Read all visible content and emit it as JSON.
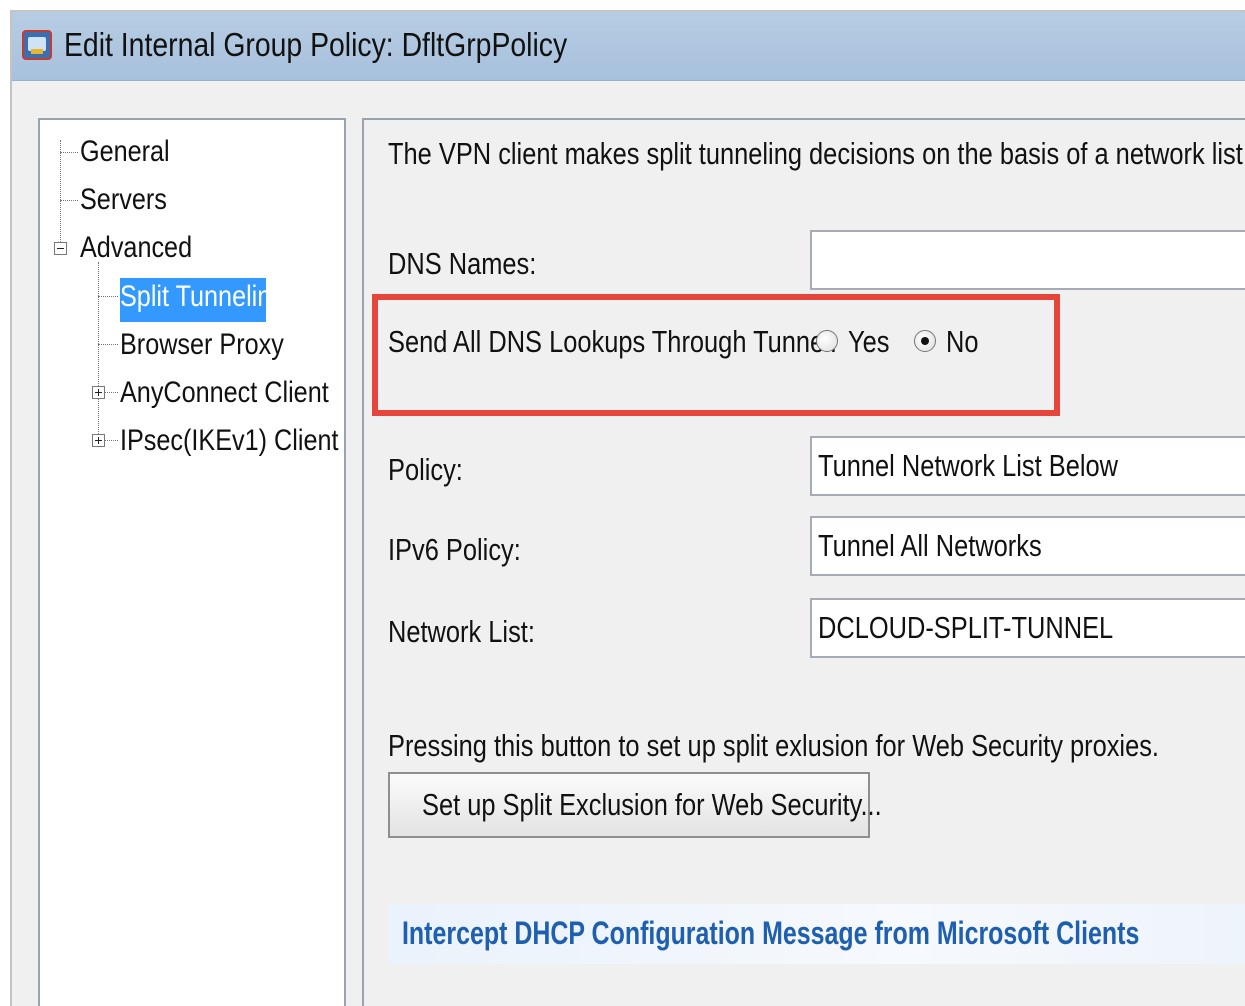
{
  "window": {
    "title": "Edit Internal Group Policy: DfltGrpPolicy",
    "icon": "group-policy-icon"
  },
  "tree": {
    "items": [
      {
        "label": "General"
      },
      {
        "label": "Servers"
      },
      {
        "label": "Advanced"
      },
      {
        "label": "Split Tunneling",
        "selected": true
      },
      {
        "label": "Browser Proxy"
      },
      {
        "label": "AnyConnect Client"
      },
      {
        "label": "IPsec(IKEv1) Client"
      }
    ]
  },
  "panel": {
    "description": "The VPN client makes split tunneling decisions on the basis of a network list that can b",
    "dns_names_label": "DNS Names:",
    "dns_names_value": "",
    "send_dns_label": "Send All DNS Lookups Through Tunnel:",
    "send_dns_yes": "Yes",
    "send_dns_no": "No",
    "send_dns_selected": "No",
    "policy_label": "Policy:",
    "policy_value": "Tunnel Network List Below",
    "ipv6_policy_label": "IPv6 Policy:",
    "ipv6_policy_value": "Tunnel All Networks",
    "network_list_label": "Network List:",
    "network_list_value": "DCLOUD-SPLIT-TUNNEL",
    "exclusion_note": "Pressing this button to set up split exlusion for Web Security proxies.",
    "exclusion_button": "Set up Split Exclusion for Web Security...",
    "dhcp_section": "Intercept DHCP Configuration Message from Microsoft Clients"
  },
  "colors": {
    "titlebar": "#a7c0dc",
    "selection": "#3399ff",
    "highlight": "#e5453a",
    "link": "#1f5fb0"
  }
}
